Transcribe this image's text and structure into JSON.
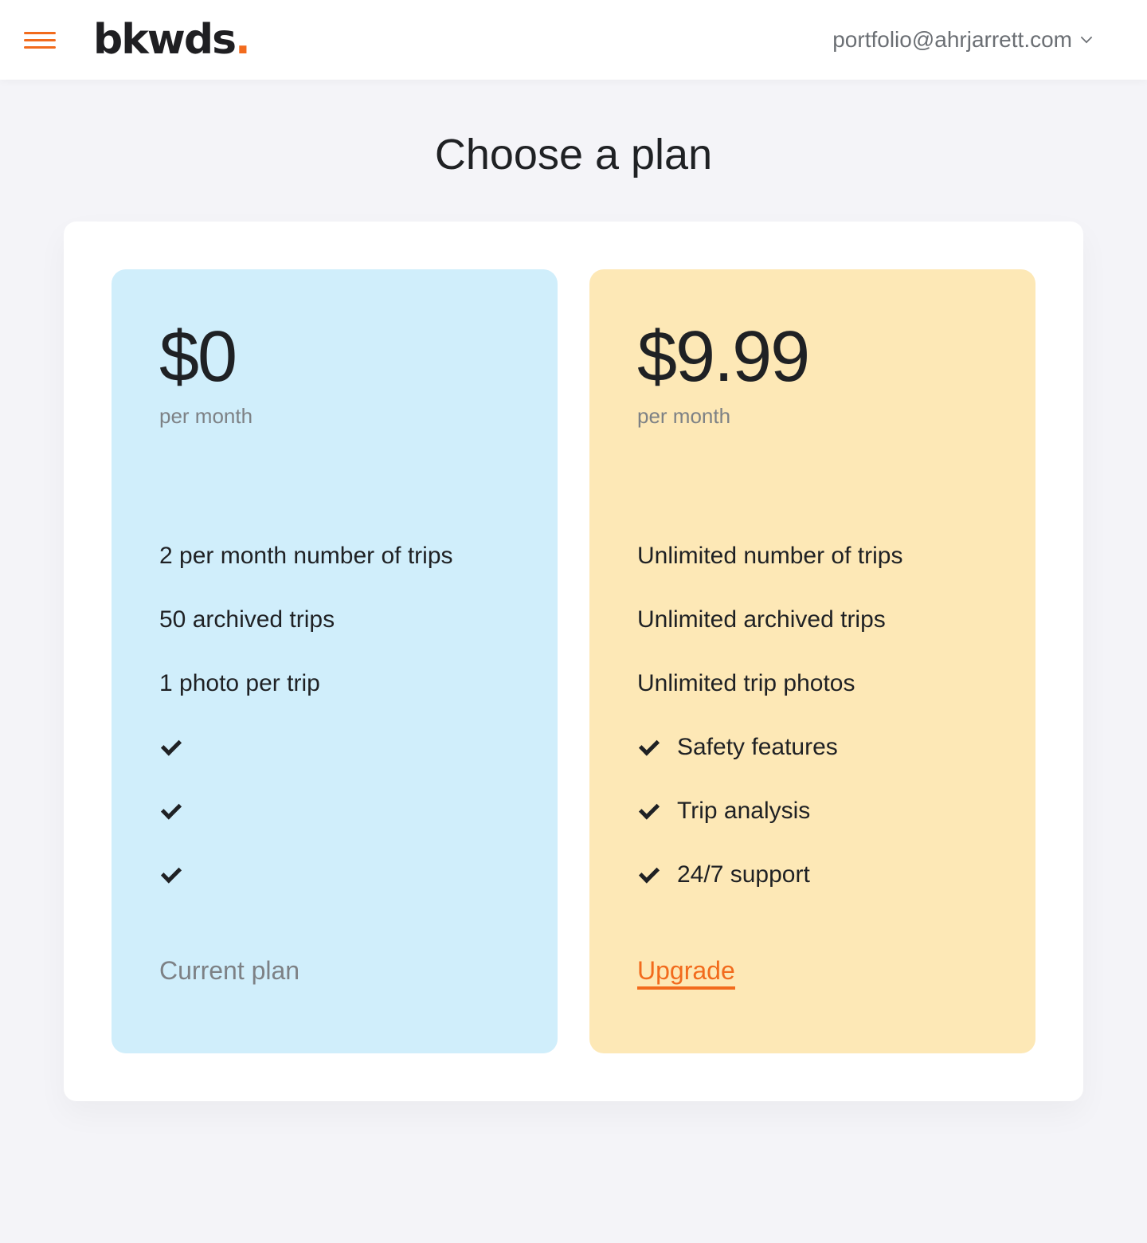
{
  "header": {
    "logo_text": "bkwds",
    "logo_dot": ".",
    "account_email": "portfolio@ahrjarrett.com"
  },
  "page": {
    "title": "Choose a plan"
  },
  "plans": [
    {
      "price": "$0",
      "period": "per month",
      "features": [
        "2 per month number of trips",
        "50 archived trips",
        "1 photo per trip"
      ],
      "checks": [
        "",
        "",
        ""
      ],
      "action_label": "Current plan"
    },
    {
      "price": "$9.99",
      "period": "per month",
      "features": [
        "Unlimited number of trips",
        "Unlimited archived trips",
        "Unlimited trip photos"
      ],
      "checks": [
        "Safety features",
        "Trip analysis",
        "24/7 support"
      ],
      "action_label": "Upgrade"
    }
  ],
  "colors": {
    "accent": "#f26b1d",
    "free_card": "#d0eefb",
    "pro_card": "#fde8b6",
    "background": "#f4f4f8"
  },
  "icons": {
    "menu": "hamburger-menu-icon",
    "dropdown": "chevron-down-icon",
    "check": "check-icon"
  }
}
